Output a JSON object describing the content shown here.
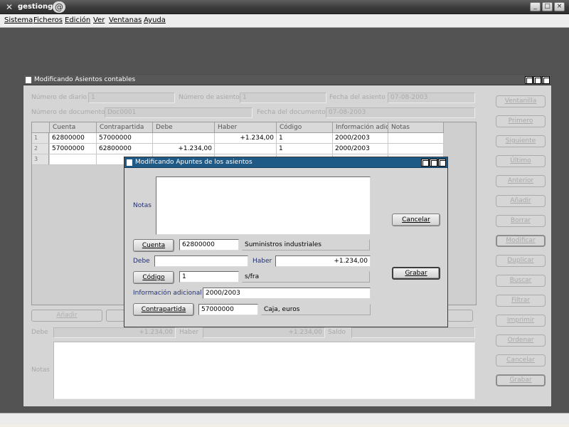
{
  "app": {
    "title": "gestiong",
    "icons": {
      "app": "x-icon",
      "launcher": "swirl-icon"
    },
    "window_buttons": [
      "_",
      "□",
      "×"
    ]
  },
  "menu": [
    "Sistema",
    "Ficheros",
    "Edición",
    "Ver",
    "Ventanas",
    "Ayuda"
  ],
  "asientos": {
    "title": "Modificando Asientos contables",
    "fields": {
      "numero_diario_label": "Número de diario",
      "numero_diario": "1",
      "numero_asiento_label": "Número de asiento",
      "numero_asiento": "1",
      "fecha_asiento_label": "Fecha del asiento",
      "fecha_asiento": "07-08-2003",
      "numero_documento_label": "Número de documento",
      "numero_documento": "Doc0001",
      "fecha_documento_label": "Fecha del documento",
      "fecha_documento": "07-08-2003"
    },
    "table": {
      "columns": [
        "Cuenta",
        "Contrapartida",
        "Debe",
        "Haber",
        "Código",
        "Información adici",
        "Notas"
      ],
      "rows": [
        [
          "62800000",
          "57000000",
          "",
          "+1.234,00",
          "1",
          "2000/2003",
          ""
        ],
        [
          "57000000",
          "62800000",
          "+1.234,00",
          "",
          "1",
          "2000/2003",
          ""
        ],
        [
          "",
          "",
          "",
          "",
          "",
          "",
          ""
        ]
      ],
      "row_numbers": [
        "1",
        "2",
        "3"
      ]
    },
    "grid_buttons": [
      "Añadir",
      ""
    ],
    "totals": {
      "debe_label": "Debe",
      "debe": "+1.234,00",
      "haber_label": "Haber",
      "haber": "+1.234,00",
      "saldo_label": "Saldo",
      "saldo": ""
    },
    "notas_label": "Notas",
    "nav_buttons": [
      "Ventanilla",
      "Primero",
      "Siguiente",
      "Último",
      "Anterior",
      "Añadir",
      "Borrar",
      "Modificar",
      "Duplicar",
      "Buscar",
      "Filtrar",
      "Imprimir",
      "Ordenar",
      "Cancelar",
      "Grabar"
    ]
  },
  "apuntes": {
    "title": "Modificando Apuntes de los asientos",
    "notas_label": "Notas",
    "notas_value": "",
    "cuenta_button": "Cuenta",
    "cuenta_value": "62800000",
    "cuenta_desc": "Suministros industriales",
    "debe_label": "Debe",
    "debe_value": "",
    "haber_label": "Haber",
    "haber_value": "+1.234,00",
    "codigo_button": "Código",
    "codigo_value": "1",
    "codigo_desc": "s/fra",
    "info_label": "Información adicional",
    "info_value": "2000/2003",
    "contrapartida_button": "Contrapartida",
    "contrapartida_value": "57000000",
    "contrapartida_desc": "Caja, euros",
    "cancelar_button": "Cancelar",
    "grabar_button": "Grabar"
  }
}
